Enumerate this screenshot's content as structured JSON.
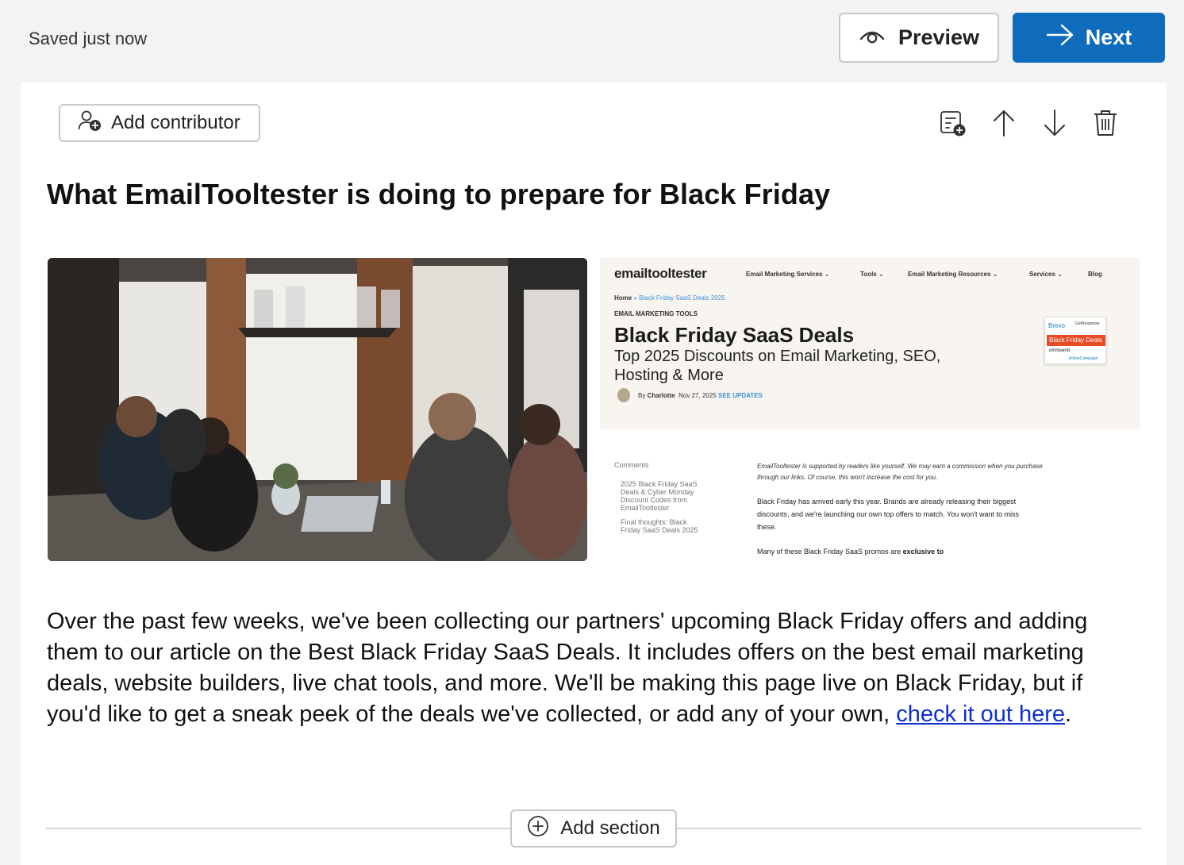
{
  "topbar": {
    "saved_status": "Saved just now",
    "preview_label": "Preview",
    "next_label": "Next"
  },
  "editor": {
    "add_contributor_label": "Add contributor",
    "section_title": "What EmailTooltester is doing to prepare for Black Friday",
    "body_text": "Over the past few weeks, we've been collecting our partners' upcoming Black Friday offers and adding them to our article on the Best Black Friday SaaS Deals. It includes offers on the best email marketing deals, website builders, live chat tools, and more. We'll be making this page live on Black Friday, but if you'd like to get a sneak peek of the deals we've collected, or add any of your own, ",
    "link_text": "check it out here",
    "body_end": ".",
    "add_section_label": "Add section"
  },
  "screenshot": {
    "logo": "emailtooltester",
    "nav": [
      "Email Marketing Services ⌄",
      "Tools ⌄",
      "Email Marketing Resources ⌄",
      "Services ⌄",
      "Blog"
    ],
    "breadcrumb_home": "Home",
    "breadcrumb_current": "» Black Friday SaaS Deals 2025",
    "kicker": "EMAIL MARKETING TOOLS",
    "headline": "Black Friday SaaS Deals",
    "subheadline": "Top 2025 Discounts on Email Marketing, SEO, Hosting & More",
    "author_prefix": "By",
    "author": "Charlotte",
    "date": "Nov 27, 2025",
    "updates": "SEE UPDATES",
    "badge_brand1": "Brevo",
    "badge_brand2": "GetResponse",
    "badge_label": "Black Friday Deals",
    "badge_brand3": "omnisend",
    "badge_brand4": "ActiveCampaign",
    "toc_heading": "Comments",
    "toc_item1": "2025 Black Friday SaaS Deals & Cyber Monday Discount Codes from EmailTooltester",
    "toc_item2": "Final thoughts: Black Friday SaaS Deals 2025",
    "disclaimer": "EmailTooltester is supported by readers like yourself. We may earn a commission when you purchase through our links. Of course, this won't increase the cost for you.",
    "para1": "Black Friday has arrived early this year. Brands are already releasing their biggest discounts, and we're launching our own top offers to match. You won't want to miss these.",
    "para2_start": "Many of these Black Friday SaaS promos are",
    "para2_bold": "exclusive to"
  },
  "colors": {
    "accent": "#0f6cbd",
    "link": "#0b2fd1",
    "page_bg": "#f3f3f3",
    "card_bg": "#ffffff"
  },
  "icons": [
    "eye-icon",
    "arrow-right-icon",
    "add-person-icon",
    "add-card-icon",
    "arrow-up-icon",
    "arrow-down-icon",
    "trash-icon",
    "plus-circle-icon"
  ]
}
